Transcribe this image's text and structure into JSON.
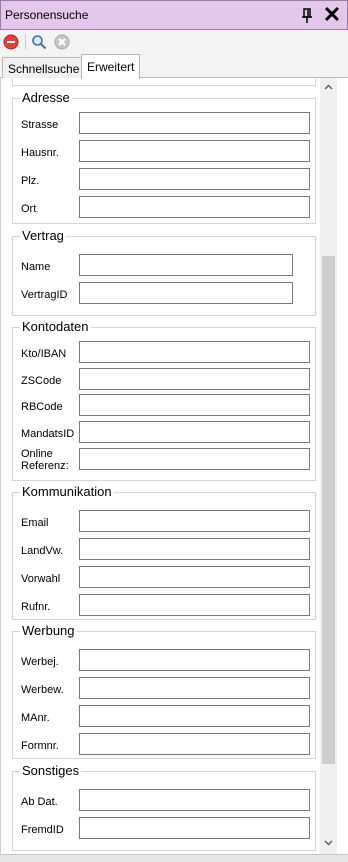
{
  "window": {
    "title": "Personensuche"
  },
  "toolbar": {
    "icons": [
      "stop-icon",
      "search-icon",
      "clear-icon"
    ]
  },
  "tabs": [
    {
      "label": "Schnellsuche",
      "active": false
    },
    {
      "label": "Erweitert",
      "active": true
    }
  ],
  "groups": {
    "adresse": {
      "title": "Adresse",
      "fields": [
        {
          "label": "Strasse",
          "value": ""
        },
        {
          "label": "Hausnr.",
          "value": ""
        },
        {
          "label": "Plz.",
          "value": ""
        },
        {
          "label": "Ort",
          "value": ""
        }
      ]
    },
    "vertrag": {
      "title": "Vertrag",
      "fields": [
        {
          "label": "Name",
          "value": ""
        },
        {
          "label": "VertragID",
          "value": ""
        }
      ]
    },
    "kontodaten": {
      "title": "Kontodaten",
      "fields": [
        {
          "label": "Kto/IBAN",
          "value": ""
        },
        {
          "label": "ZSCode",
          "value": ""
        },
        {
          "label": "RBCode",
          "value": ""
        },
        {
          "label": "MandatsID",
          "value": ""
        },
        {
          "label_line1": "Online",
          "label_line2": "Referenz:",
          "value": ""
        }
      ]
    },
    "kommunikation": {
      "title": "Kommunikation",
      "fields": [
        {
          "label": "Email",
          "value": ""
        },
        {
          "label": "LandVw.",
          "value": ""
        },
        {
          "label": "Vorwahl",
          "value": ""
        },
        {
          "label": "Rufnr.",
          "value": ""
        }
      ]
    },
    "werbung": {
      "title": "Werbung",
      "fields": [
        {
          "label": "Werbej.",
          "value": ""
        },
        {
          "label": "Werbew.",
          "value": ""
        },
        {
          "label": "MAnr.",
          "value": ""
        },
        {
          "label": "Formnr.",
          "value": ""
        }
      ]
    },
    "sonstiges": {
      "title": "Sonstiges",
      "fields": [
        {
          "label": "Ab Dat.",
          "value": ""
        },
        {
          "label": "FremdID",
          "value": ""
        }
      ]
    }
  },
  "colors": {
    "titlebar_bg": "#e3c8ec",
    "stop_icon": "#e04040",
    "scroll_thumb": "#cdcdcd"
  }
}
